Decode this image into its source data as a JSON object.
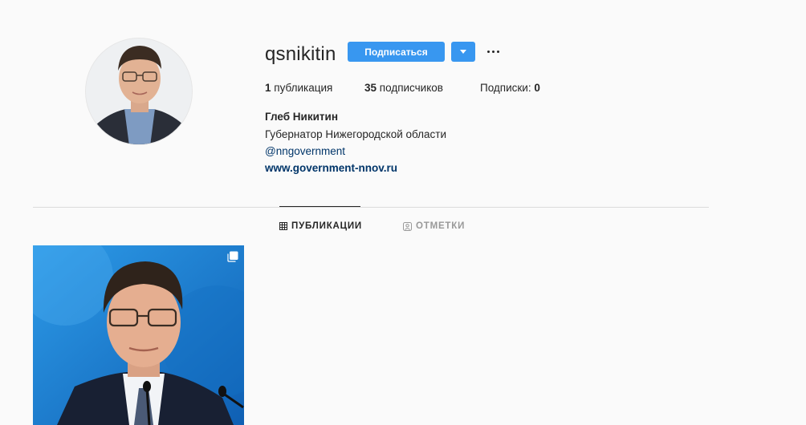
{
  "profile": {
    "username": "qsnikitin",
    "follow_label": "Подписаться",
    "stats": {
      "posts_count": "1",
      "posts_label": "публикация",
      "followers_count": "35",
      "followers_label": "подписчиков",
      "following_label": "Подписки:",
      "following_count": "0"
    },
    "bio": {
      "name": "Глеб Никитин",
      "description": "Губернатор Нижегородской области",
      "mention": "@nngovernment",
      "website": "www.government-nnov.ru"
    }
  },
  "tabs": [
    {
      "label": "ПУБЛИКАЦИИ",
      "icon": "grid-icon",
      "active": true
    },
    {
      "label": "ОТМЕТКИ",
      "icon": "tagged-icon",
      "active": false
    }
  ],
  "colors": {
    "background": "#fafafa",
    "accent": "#3897f0",
    "link": "#003569",
    "divider": "#dbdbdb",
    "post_background": "#1f86d6"
  },
  "posts": [
    {
      "type": "carousel",
      "icon": "multiple-posts-icon"
    }
  ]
}
